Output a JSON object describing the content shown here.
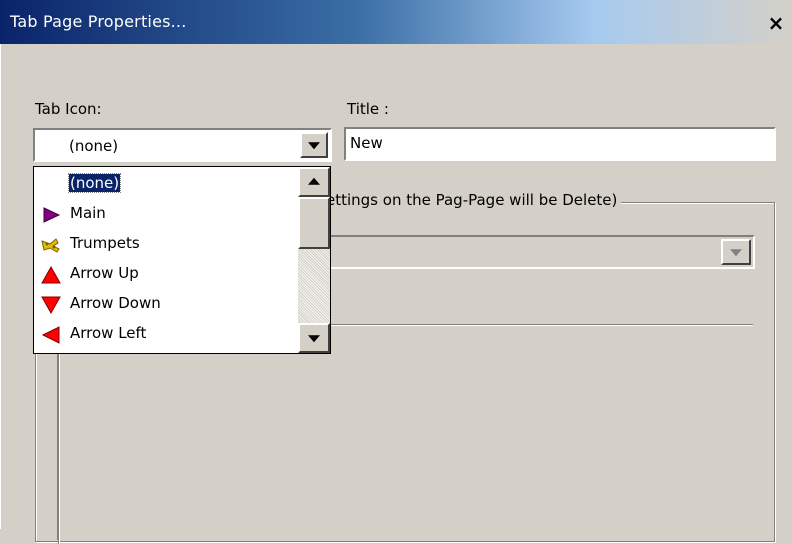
{
  "window": {
    "title": "Tab Page Properties...",
    "close_label": "×"
  },
  "form": {
    "tab_icon_label": "Tab Icon:",
    "tab_icon_value": "(none)",
    "title_label": "Title :",
    "title_value": "New",
    "group_label": "ettings on the Pag-Page will be Delete)"
  },
  "dropdown": {
    "items": [
      {
        "label": "(none)",
        "icon": "none",
        "selected": true
      },
      {
        "label": "Main",
        "icon": "purple-play-icon"
      },
      {
        "label": "Trumpets",
        "icon": "trumpets-icon"
      },
      {
        "label": "Arrow Up",
        "icon": "red-arrow-up-icon"
      },
      {
        "label": "Arrow Down",
        "icon": "red-arrow-down-icon"
      },
      {
        "label": "Arrow Left",
        "icon": "red-arrow-left-icon"
      }
    ]
  },
  "colors": {
    "face": "#d4d0c8",
    "title_gradient_start": "#0a246a",
    "selection": "#0a246a",
    "icon_red": "#ff0000",
    "icon_purple": "#800080"
  }
}
